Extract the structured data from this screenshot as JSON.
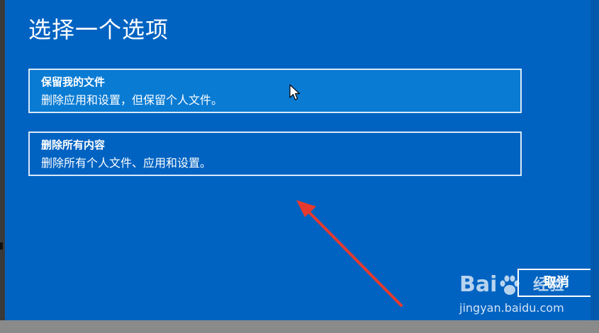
{
  "page": {
    "title": "选择一个选项"
  },
  "options": [
    {
      "title": "保留我的文件",
      "description": "删除应用和设置，但保留个人文件。",
      "selected": true
    },
    {
      "title": "删除所有内容",
      "description": "删除所有个人文件、应用和设置。",
      "selected": false
    }
  ],
  "footer": {
    "cancel_label": "取消"
  },
  "watermark": {
    "logo_text": "Bai",
    "brand_cn": "经验",
    "url": "jingyan.baidu.com"
  },
  "colors": {
    "background": "#0063c2",
    "selected_option": "#0a7bd3",
    "annotation_arrow": "#e63a2e"
  }
}
